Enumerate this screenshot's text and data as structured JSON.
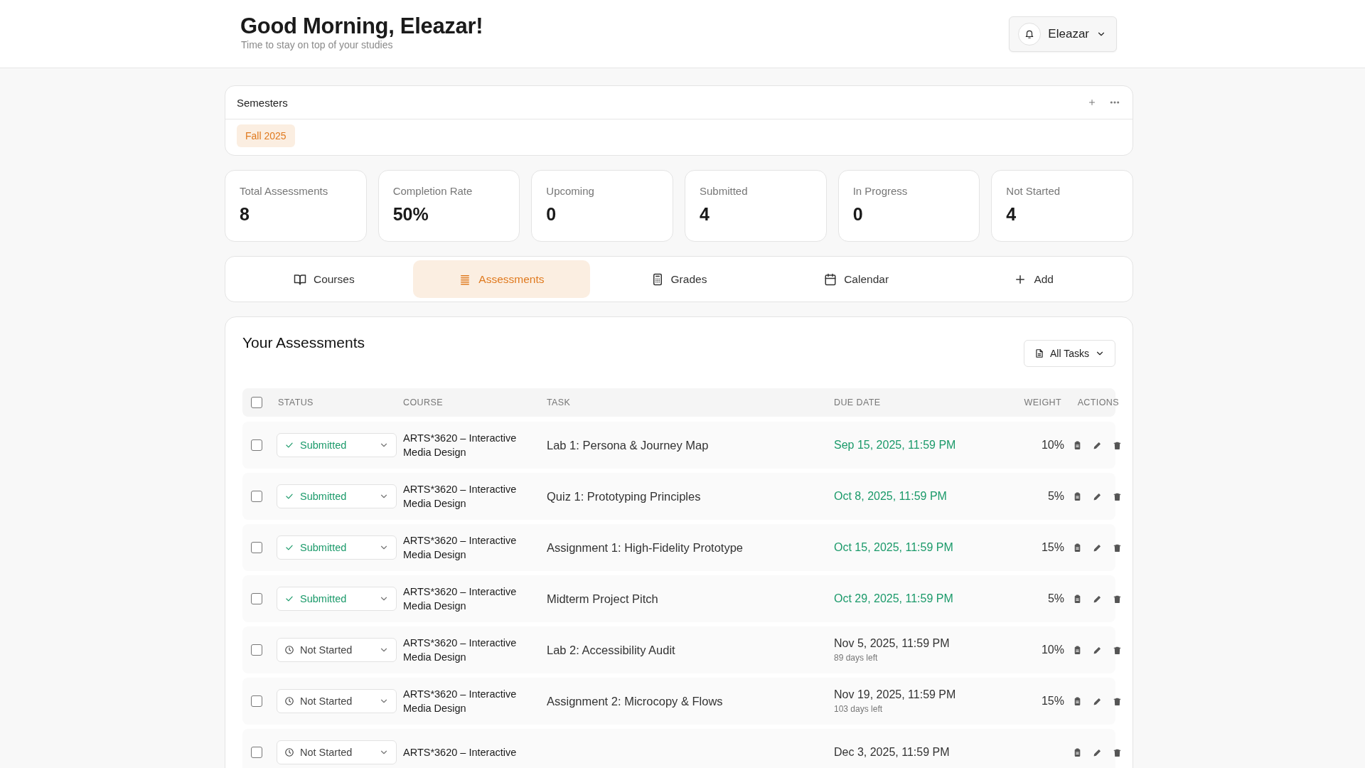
{
  "header": {
    "greeting": "Good Morning, Eleazar!",
    "subtitle": "Time to stay on top of your studies",
    "user_menu": {
      "label": "Eleazar"
    }
  },
  "semesters": {
    "title": "Semesters",
    "items": [
      {
        "label": "Fall 2025",
        "selected": true
      }
    ]
  },
  "stats": [
    {
      "label": "Total Assessments",
      "value": "8"
    },
    {
      "label": "Completion Rate",
      "value": "50%"
    },
    {
      "label": "Upcoming",
      "value": "0"
    },
    {
      "label": "Submitted",
      "value": "4"
    },
    {
      "label": "In Progress",
      "value": "0"
    },
    {
      "label": "Not Started",
      "value": "4"
    }
  ],
  "nav_tabs": [
    {
      "kind": "courses",
      "label": "Courses",
      "selected": false
    },
    {
      "kind": "assessments",
      "label": "Assessments",
      "selected": true
    },
    {
      "kind": "grades",
      "label": "Grades",
      "selected": false
    },
    {
      "kind": "calendar",
      "label": "Calendar",
      "selected": false
    },
    {
      "kind": "add",
      "label": "Add",
      "selected": false
    }
  ],
  "assessments": {
    "title": "Your Assessments",
    "filter": {
      "label": "All Tasks"
    },
    "select_all": {
      "checked": false
    },
    "columns": [
      "STATUS",
      "COURSE",
      "TASK",
      "DUE DATE",
      "WEIGHT",
      "ACTIONS"
    ],
    "rows": [
      {
        "checked": false,
        "status": {
          "kind": "submitted",
          "label": "Submitted"
        },
        "course": "ARTS*3620 – Interactive Media Design",
        "task": "Lab 1: Persona & Journey Map",
        "due": "Sep 15, 2025, 11:59 PM",
        "weight": "10%"
      },
      {
        "checked": false,
        "status": {
          "kind": "submitted",
          "label": "Submitted"
        },
        "course": "ARTS*3620 – Interactive Media Design",
        "task": "Quiz 1: Prototyping Principles",
        "due": "Oct 8, 2025, 11:59 PM",
        "weight": "5%"
      },
      {
        "checked": false,
        "status": {
          "kind": "submitted",
          "label": "Submitted"
        },
        "course": "ARTS*3620 – Interactive Media Design",
        "task": "Assignment 1: High-Fidelity Prototype",
        "due": "Oct 15, 2025, 11:59 PM",
        "weight": "15%"
      },
      {
        "checked": false,
        "status": {
          "kind": "submitted",
          "label": "Submitted"
        },
        "course": "ARTS*3620 – Interactive Media Design",
        "task": "Midterm Project Pitch",
        "due": "Oct 29, 2025, 11:59 PM",
        "weight": "5%"
      },
      {
        "checked": false,
        "status": {
          "kind": "not_started",
          "label": "Not Started"
        },
        "course": "ARTS*3620 – Interactive Media Design",
        "task": "Lab 2: Accessibility Audit",
        "due": "Nov 5, 2025, 11:59 PM",
        "days_left": "89 days left",
        "weight": "10%"
      },
      {
        "checked": false,
        "status": {
          "kind": "not_started",
          "label": "Not Started"
        },
        "course": "ARTS*3620 – Interactive Media Design",
        "task": "Assignment 2: Microcopy & Flows",
        "due": "Nov 19, 2025, 11:59 PM",
        "days_left": "103 days left",
        "weight": "15%"
      },
      {
        "checked": false,
        "status": {
          "kind": "not_started",
          "label": "Not Started"
        },
        "course": "ARTS*3620 – Interactive",
        "due": "Dec 3, 2025, 11:59 PM"
      }
    ]
  }
}
